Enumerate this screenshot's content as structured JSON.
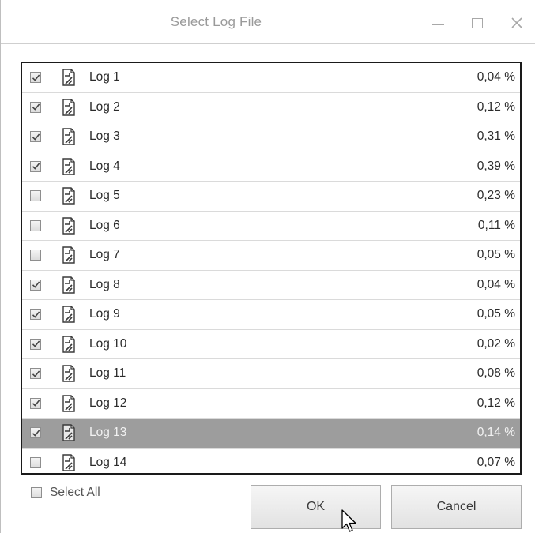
{
  "window": {
    "title": "Select Log File",
    "controls": [
      "minimize-icon",
      "maximize-icon",
      "close-icon"
    ]
  },
  "logs": [
    {
      "name": "Log 1",
      "percent": "0,04 %",
      "checked": true
    },
    {
      "name": "Log 2",
      "percent": "0,12 %",
      "checked": true
    },
    {
      "name": "Log 3",
      "percent": "0,31 %",
      "checked": true
    },
    {
      "name": "Log 4",
      "percent": "0,39 %",
      "checked": true
    },
    {
      "name": "Log 5",
      "percent": "0,23 %",
      "checked": false
    },
    {
      "name": "Log 6",
      "percent": "0,11 %",
      "checked": false
    },
    {
      "name": "Log 7",
      "percent": "0,05 %",
      "checked": false
    },
    {
      "name": "Log 8",
      "percent": "0,04 %",
      "checked": true
    },
    {
      "name": "Log 9",
      "percent": "0,05 %",
      "checked": true
    },
    {
      "name": "Log 10",
      "percent": "0,02 %",
      "checked": true
    },
    {
      "name": "Log 11",
      "percent": "0,08 %",
      "checked": true
    },
    {
      "name": "Log 12",
      "percent": "0,12 %",
      "checked": true
    },
    {
      "name": "Log 13",
      "percent": "0,14 %",
      "checked": true,
      "selected": true
    },
    {
      "name": "Log 14",
      "percent": "0,07 %",
      "checked": false
    }
  ],
  "footer": {
    "select_all_label": "Select All",
    "select_all_checked": false,
    "ok_label": "OK",
    "cancel_label": "Cancel"
  },
  "colors": {
    "selected_row": "#9d9d9d",
    "title_text": "#9a9a9a"
  }
}
